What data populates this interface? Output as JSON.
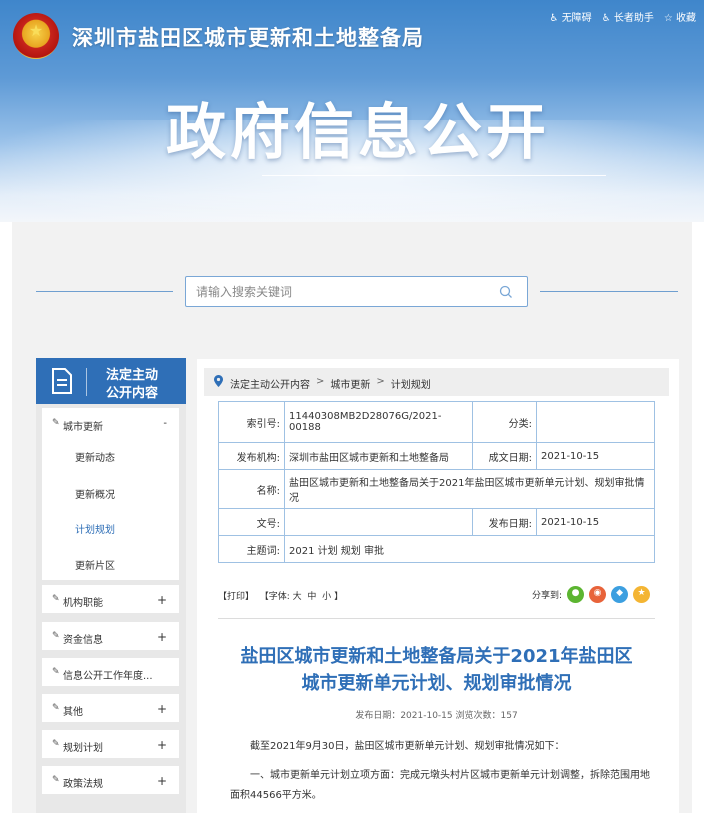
{
  "header": {
    "org_title": "深圳市盐田区城市更新和土地整备局",
    "big_title": "政府信息公开",
    "top_links": [
      {
        "label": "无障碍",
        "icon": "accessibility-icon"
      },
      {
        "label": "长者助手",
        "icon": "elder-icon"
      },
      {
        "label": "收藏",
        "icon": "star-icon"
      }
    ]
  },
  "search": {
    "placeholder": "请输入搜索关键词",
    "value": ""
  },
  "sidebar": {
    "heading_line1": "法定主动",
    "heading_line2": "公开内容",
    "expanded": {
      "label": "城市更新",
      "toggle": "-",
      "items": [
        {
          "label": "更新动态",
          "active": false
        },
        {
          "label": "更新概况",
          "active": false
        },
        {
          "label": "计划规划",
          "active": true
        },
        {
          "label": "更新片区",
          "active": false
        }
      ]
    },
    "menus": [
      {
        "label": "机构职能",
        "toggle": "+"
      },
      {
        "label": "资金信息",
        "toggle": "+"
      },
      {
        "label": "信息公开工作年度...",
        "toggle": ""
      },
      {
        "label": "其他",
        "toggle": "+"
      },
      {
        "label": "规划计划",
        "toggle": "+"
      },
      {
        "label": "政策法规",
        "toggle": "+"
      }
    ]
  },
  "breadcrumb": [
    "法定主动公开内容",
    "城市更新",
    "计划规划"
  ],
  "breadcrumb_sep": ">",
  "meta": {
    "index_label": "索引号:",
    "index_value": "11440308MB2D28076G/2021-00188",
    "category_label": "分类:",
    "category_value": "",
    "publisher_label": "发布机构:",
    "publisher_value": "深圳市盐田区城市更新和土地整备局",
    "created_label": "成文日期:",
    "created_value": "2021-10-15",
    "name_label": "名称:",
    "name_value": "盐田区城市更新和土地整备局关于2021年盐田区城市更新单元计划、规划审批情况",
    "docno_label": "文号:",
    "docno_value": "",
    "published_label": "发布日期:",
    "published_value": "2021-10-15",
    "keywords_label": "主题词:",
    "keywords_value": "2021 计划 规划 审批"
  },
  "tools": {
    "print": "【打印】",
    "font_prefix": "【字体:",
    "font_large": "大",
    "font_medium": "中",
    "font_small": "小",
    "font_suffix": "】",
    "share_label": "分享到:",
    "share_icons": [
      {
        "name": "wechat-icon",
        "color": "#5cb531",
        "glyph": "●"
      },
      {
        "name": "weibo-icon",
        "color": "#e8633a",
        "glyph": "◉"
      },
      {
        "name": "qq-icon",
        "color": "#3c9fe0",
        "glyph": "◆"
      },
      {
        "name": "qzone-icon",
        "color": "#f4b533",
        "glyph": "★"
      }
    ]
  },
  "article": {
    "title_line1": "盐田区城市更新和土地整备局关于2021年盐田区",
    "title_line2": "城市更新单元计划、规划审批情况",
    "publish_meta": "发布日期：2021-10-15   浏览次数：157",
    "para1": "截至2021年9月30日，盐田区城市更新单元计划、规划审批情况如下：",
    "para2": "一、城市更新单元计划立项方面：完成元墩头村片区城市更新单元计划调整，拆除范围用地面积44566平方米。"
  },
  "colors": {
    "accent": "#2f6fb7",
    "table_border": "#9fc1e3",
    "panel_bg": "#f2f2f2"
  }
}
